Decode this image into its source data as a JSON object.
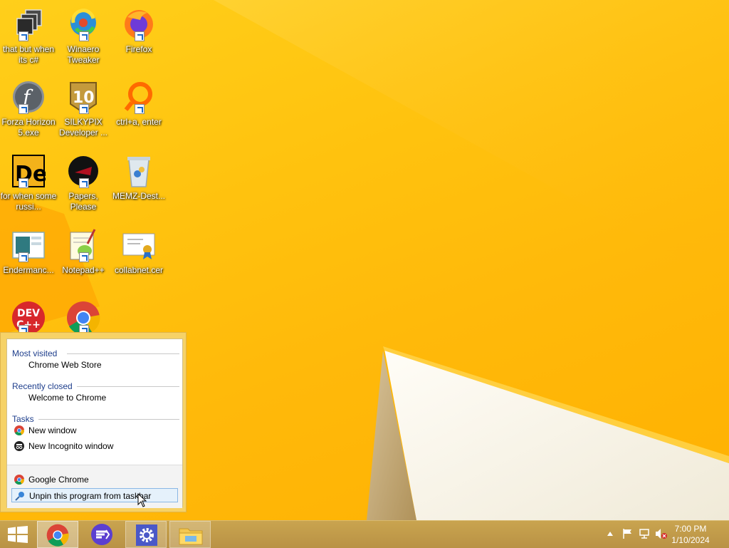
{
  "desktop": {
    "icons": [
      {
        "label": "that but when its c#",
        "icon": "stack-windows-icon"
      },
      {
        "label": "Winaero Tweaker",
        "icon": "winaero-tweaker-icon"
      },
      {
        "label": "Firefox",
        "icon": "firefox-icon"
      },
      {
        "label": "Forza Horizon 5.exe",
        "icon": "flash-f-icon"
      },
      {
        "label": "SILKYPIX Developer ...",
        "icon": "silkypix-10-icon"
      },
      {
        "label": "ctrl+a, enter",
        "icon": "orange-ring-icon"
      },
      {
        "label": "for when some russi...",
        "icon": "de-logo-icon"
      },
      {
        "label": "Papers, Please",
        "icon": "papers-please-icon"
      },
      {
        "label": "MEMZ-Dest...",
        "icon": "recycle-bin-icon"
      },
      {
        "label": "Endermanc...",
        "icon": "window-screenshot-icon"
      },
      {
        "label": "Notepad++",
        "icon": "notepad-plus-plus-icon"
      },
      {
        "label": "collabnet.cer",
        "icon": "certificate-icon"
      },
      {
        "label": "DEV C++",
        "icon": "dev-cpp-icon"
      },
      {
        "label": "",
        "icon": "chrome-icon"
      }
    ],
    "devcpp_badge": {
      "line1": "DEV",
      "line2": "C++"
    }
  },
  "jumplist": {
    "sections": [
      {
        "heading": "Most visited",
        "items": [
          "Chrome Web Store"
        ]
      },
      {
        "heading": "Recently closed",
        "items": [
          "Welcome to Chrome"
        ]
      },
      {
        "heading": "Tasks",
        "items": [
          "New window",
          "New Incognito window"
        ]
      }
    ],
    "footer": {
      "app": "Google Chrome",
      "unpin": "Unpin this program from taskbar"
    }
  },
  "taskbar": {
    "buttons": [
      "start-icon",
      "chrome-icon",
      "feather-app-icon",
      "settings-gear-icon",
      "file-explorer-icon"
    ],
    "clock": {
      "time": "7:00 PM",
      "date": "1/10/2024"
    }
  },
  "colors": {
    "accent": "#ffbf0a",
    "heading_blue": "#1e3e8c",
    "taskbar": "#c09a4a"
  }
}
